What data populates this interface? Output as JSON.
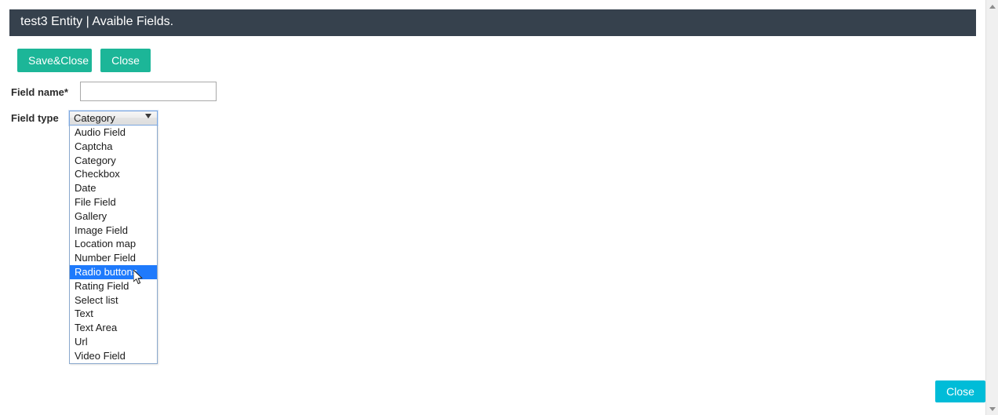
{
  "header": {
    "title": "test3 Entity | Avaible Fields."
  },
  "toolbar": {
    "save_close_label": "Save&Close",
    "close_label": "Close"
  },
  "form": {
    "field_name": {
      "label": "Field name*",
      "value": "",
      "placeholder": ""
    },
    "field_type": {
      "label": "Field type",
      "selected": "Category",
      "expanded": true,
      "highlighted": "Radio buttons",
      "options": [
        "Audio Field",
        "Captcha",
        "Category",
        "Checkbox",
        "Date",
        "File Field",
        "Gallery",
        "Image Field",
        "Location map",
        "Number Field",
        "Radio buttons",
        "Rating Field",
        "Select list",
        "Text",
        "Text Area",
        "Url",
        "Video Field"
      ]
    }
  },
  "footer": {
    "close_label": "Close"
  },
  "colors": {
    "header_bg": "#36414d",
    "toolbar_button": "#1cb698",
    "footer_button": "#00bcd8",
    "option_highlight": "#1e7afc",
    "page_bg": "#ffffff"
  },
  "icons": {
    "select_chevron": "chevron-down-icon",
    "scroll_up": "scroll-up-arrow-icon",
    "scroll_down": "scroll-down-arrow-icon",
    "cursor": "mouse-pointer-icon"
  }
}
